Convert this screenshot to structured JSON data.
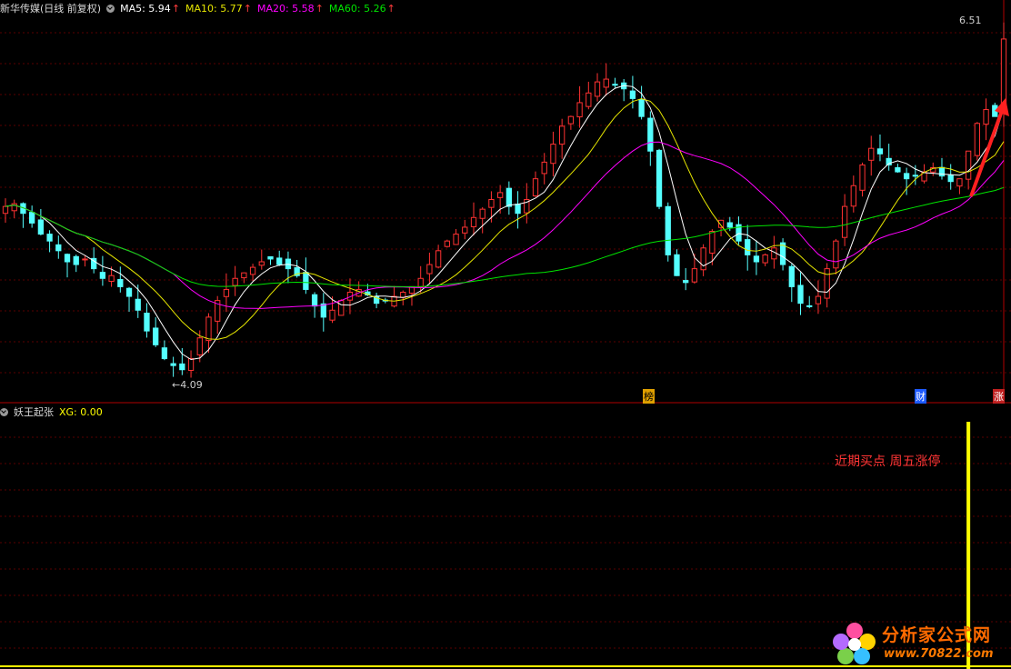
{
  "header": {
    "stock_title": "新华传媒(日线 前复权)",
    "ma5": "MA5: 5.94",
    "ma10": "MA10: 5.77",
    "ma20": "MA20: 5.58",
    "ma60": "MA60: 5.26",
    "up_arrow": "↑"
  },
  "price_labels": {
    "high": "6.51",
    "low": "4.09",
    "low_arrow": "←",
    "high_arrow": "→"
  },
  "markers": {
    "bang": "榜",
    "cai": "财",
    "zhang": "涨"
  },
  "indicator_header": {
    "name": "妖王起张",
    "xg": "XG: 0.00"
  },
  "annotation": "近期买点 周五涨停",
  "watermark": {
    "title": "分析家公式网",
    "url": "www.70822.com"
  },
  "colors": {
    "up": "#ff3232",
    "down": "#54ffff",
    "ma5": "#ffffff",
    "ma10": "#e6e600",
    "ma20": "#ff00ff",
    "ma60": "#00e400",
    "grid": "#5a0000",
    "xg": "#ffff00"
  },
  "chart_data": [
    {
      "type": "candlestick",
      "ylim": [
        4.0,
        6.7
      ],
      "price_extremes": {
        "high": 6.51,
        "low": 4.09
      },
      "closes_approx": [
        5.3,
        5.32,
        5.25,
        5.18,
        5.1,
        5.05,
        4.98,
        4.9,
        4.88,
        4.92,
        4.85,
        4.78,
        4.8,
        4.72,
        4.65,
        4.55,
        4.4,
        4.3,
        4.2,
        4.15,
        4.12,
        4.2,
        4.35,
        4.5,
        4.62,
        4.7,
        4.78,
        4.82,
        4.86,
        4.9,
        4.92,
        4.88,
        4.85,
        4.8,
        4.7,
        4.58,
        4.5,
        4.55,
        4.62,
        4.68,
        4.7,
        4.66,
        4.6,
        4.62,
        4.65,
        4.68,
        4.72,
        4.78,
        4.88,
        4.98,
        5.05,
        5.1,
        5.15,
        5.22,
        5.28,
        5.35,
        5.4,
        5.3,
        5.25,
        5.35,
        5.5,
        5.62,
        5.75,
        5.88,
        5.95,
        6.05,
        6.12,
        6.2,
        6.22,
        6.18,
        6.15,
        6.08,
        5.95,
        5.7,
        5.3,
        4.95,
        4.8,
        4.75,
        4.85,
        5.0,
        5.12,
        5.2,
        5.15,
        5.05,
        4.95,
        4.9,
        4.95,
        5.0,
        4.88,
        4.72,
        4.6,
        4.58,
        4.65,
        4.85,
        5.05,
        5.3,
        5.45,
        5.6,
        5.72,
        5.68,
        5.6,
        5.55,
        5.5,
        5.52,
        5.55,
        5.58,
        5.52,
        5.48,
        5.5,
        5.7,
        5.9,
        6.0,
        5.95,
        6.51
      ],
      "ma_series": [
        {
          "name": "MA5",
          "last": 5.94
        },
        {
          "name": "MA10",
          "last": 5.77
        },
        {
          "name": "MA20",
          "last": 5.58
        },
        {
          "name": "MA60",
          "last": 5.26
        }
      ]
    },
    {
      "type": "bar",
      "series": [
        {
          "name": "XG",
          "last": 0.0
        }
      ],
      "spike_index_from_end": 4,
      "ylim": [
        0,
        1
      ]
    }
  ]
}
